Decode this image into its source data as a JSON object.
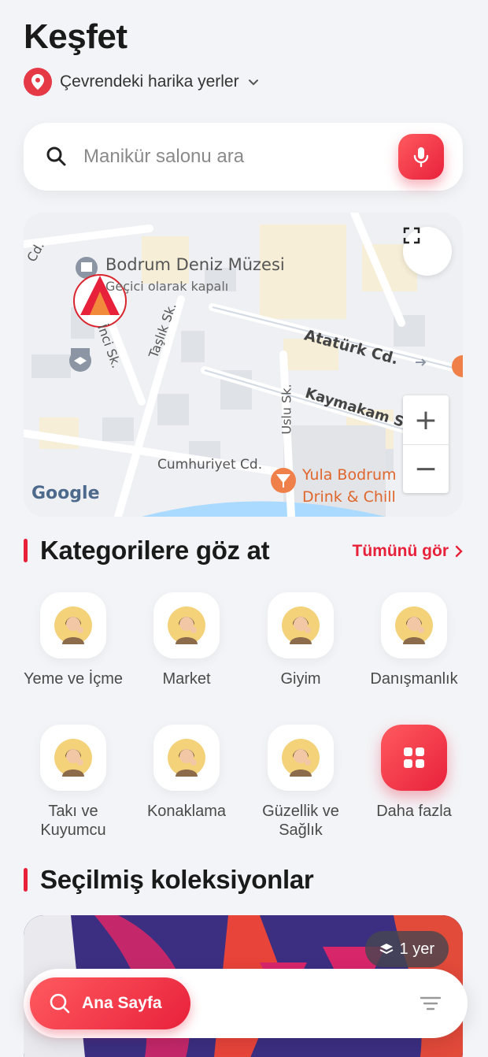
{
  "header": {
    "title": "Keşfet",
    "location_label": "Çevrendeki harika yerler"
  },
  "search": {
    "placeholder": "Manikür salonu ara"
  },
  "map": {
    "labels": {
      "museum": "Bodrum Deniz Müzesi",
      "museum_status": "Geçici olarak kapalı",
      "street_ataturk": "Atatürk Cd.",
      "street_kaymakam": "Kaymakam Sk.",
      "street_uslu": "Uslu Sk.",
      "street_taslik": "Taşlık Sk.",
      "street_inci": "İnci Sk.",
      "street_cumhuriyet": "Cumhuriyet Cd.",
      "street_cd": "Cd.",
      "bar_line1": "Yula Bodrum",
      "bar_line2": "Drink & Chill",
      "google": "Google"
    },
    "zoom_in": "+",
    "zoom_out": "−"
  },
  "categories_section": {
    "title": "Kategorilere göz at",
    "see_all": "Tümünü gör",
    "items": [
      {
        "label": "Yeme ve İçme"
      },
      {
        "label": "Market"
      },
      {
        "label": "Giyim"
      },
      {
        "label": "Danışmanlık"
      },
      {
        "label": "Takı ve Kuyumcu"
      },
      {
        "label": "Konaklama"
      },
      {
        "label": "Güzellik ve Sağlık"
      },
      {
        "label": "Daha fazla"
      }
    ]
  },
  "collections_section": {
    "title": "Seçilmiş koleksiyonlar",
    "badge": "1 yer"
  },
  "bottom_nav": {
    "home_label": "Ana Sayfa"
  },
  "colors": {
    "accent": "#e8213b",
    "background": "#f3f4f7"
  }
}
